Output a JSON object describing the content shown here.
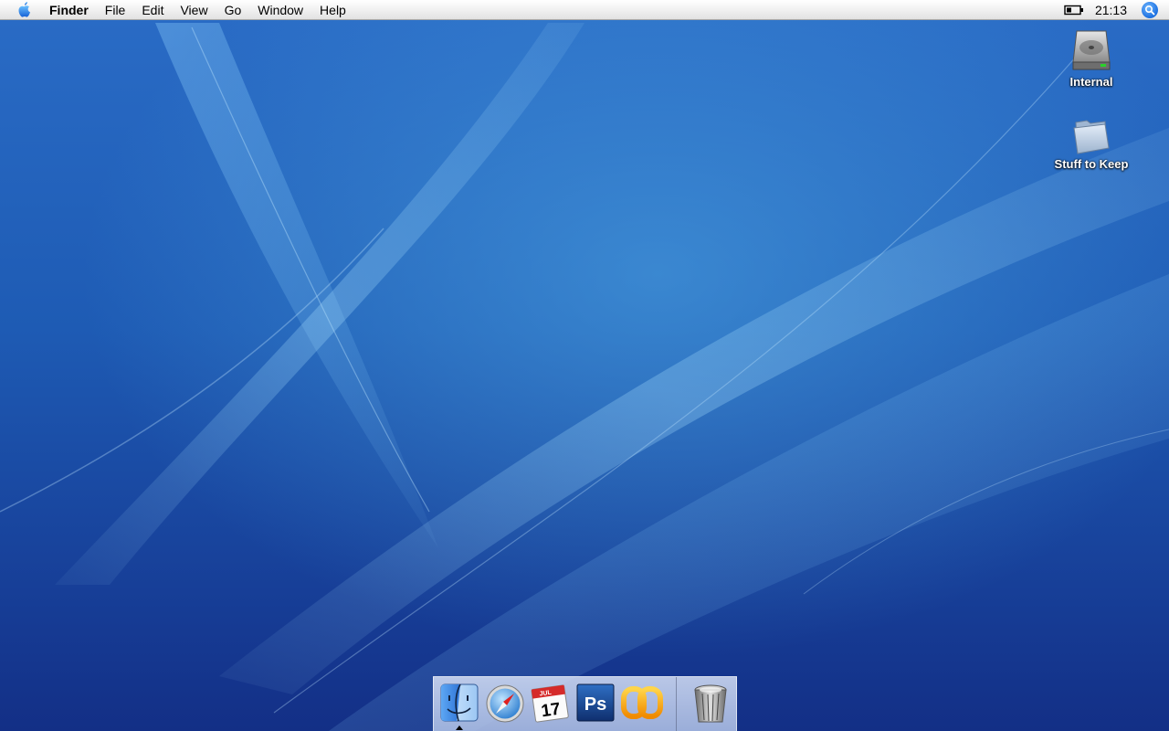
{
  "menubar": {
    "apple_icon": "apple-logo-icon",
    "app_name": "Finder",
    "items": [
      "File",
      "Edit",
      "View",
      "Go",
      "Window",
      "Help"
    ],
    "battery_icon": "battery-icon",
    "clock": "21:13",
    "spotlight_icon": "spotlight-search-icon"
  },
  "desktop_icons": [
    {
      "label": "Internal",
      "icon": "hard-drive-icon"
    },
    {
      "label": "Stuff to Keep",
      "icon": "folder-icon"
    }
  ],
  "dock": {
    "apps": [
      {
        "icon": "finder-icon",
        "running": true
      },
      {
        "icon": "safari-icon",
        "running": false
      },
      {
        "icon": "ical-icon",
        "running": false,
        "month": "JUL",
        "day": "17"
      },
      {
        "icon": "photoshop-icon",
        "running": false,
        "text": "Ps"
      },
      {
        "icon": "chain-links-app-icon",
        "running": false
      }
    ],
    "trash_icon": "trash-icon"
  },
  "colors": {
    "desktop_top": "#2a6cc6",
    "desktop_bottom": "#132f86",
    "accent": "#1b6fe0"
  }
}
